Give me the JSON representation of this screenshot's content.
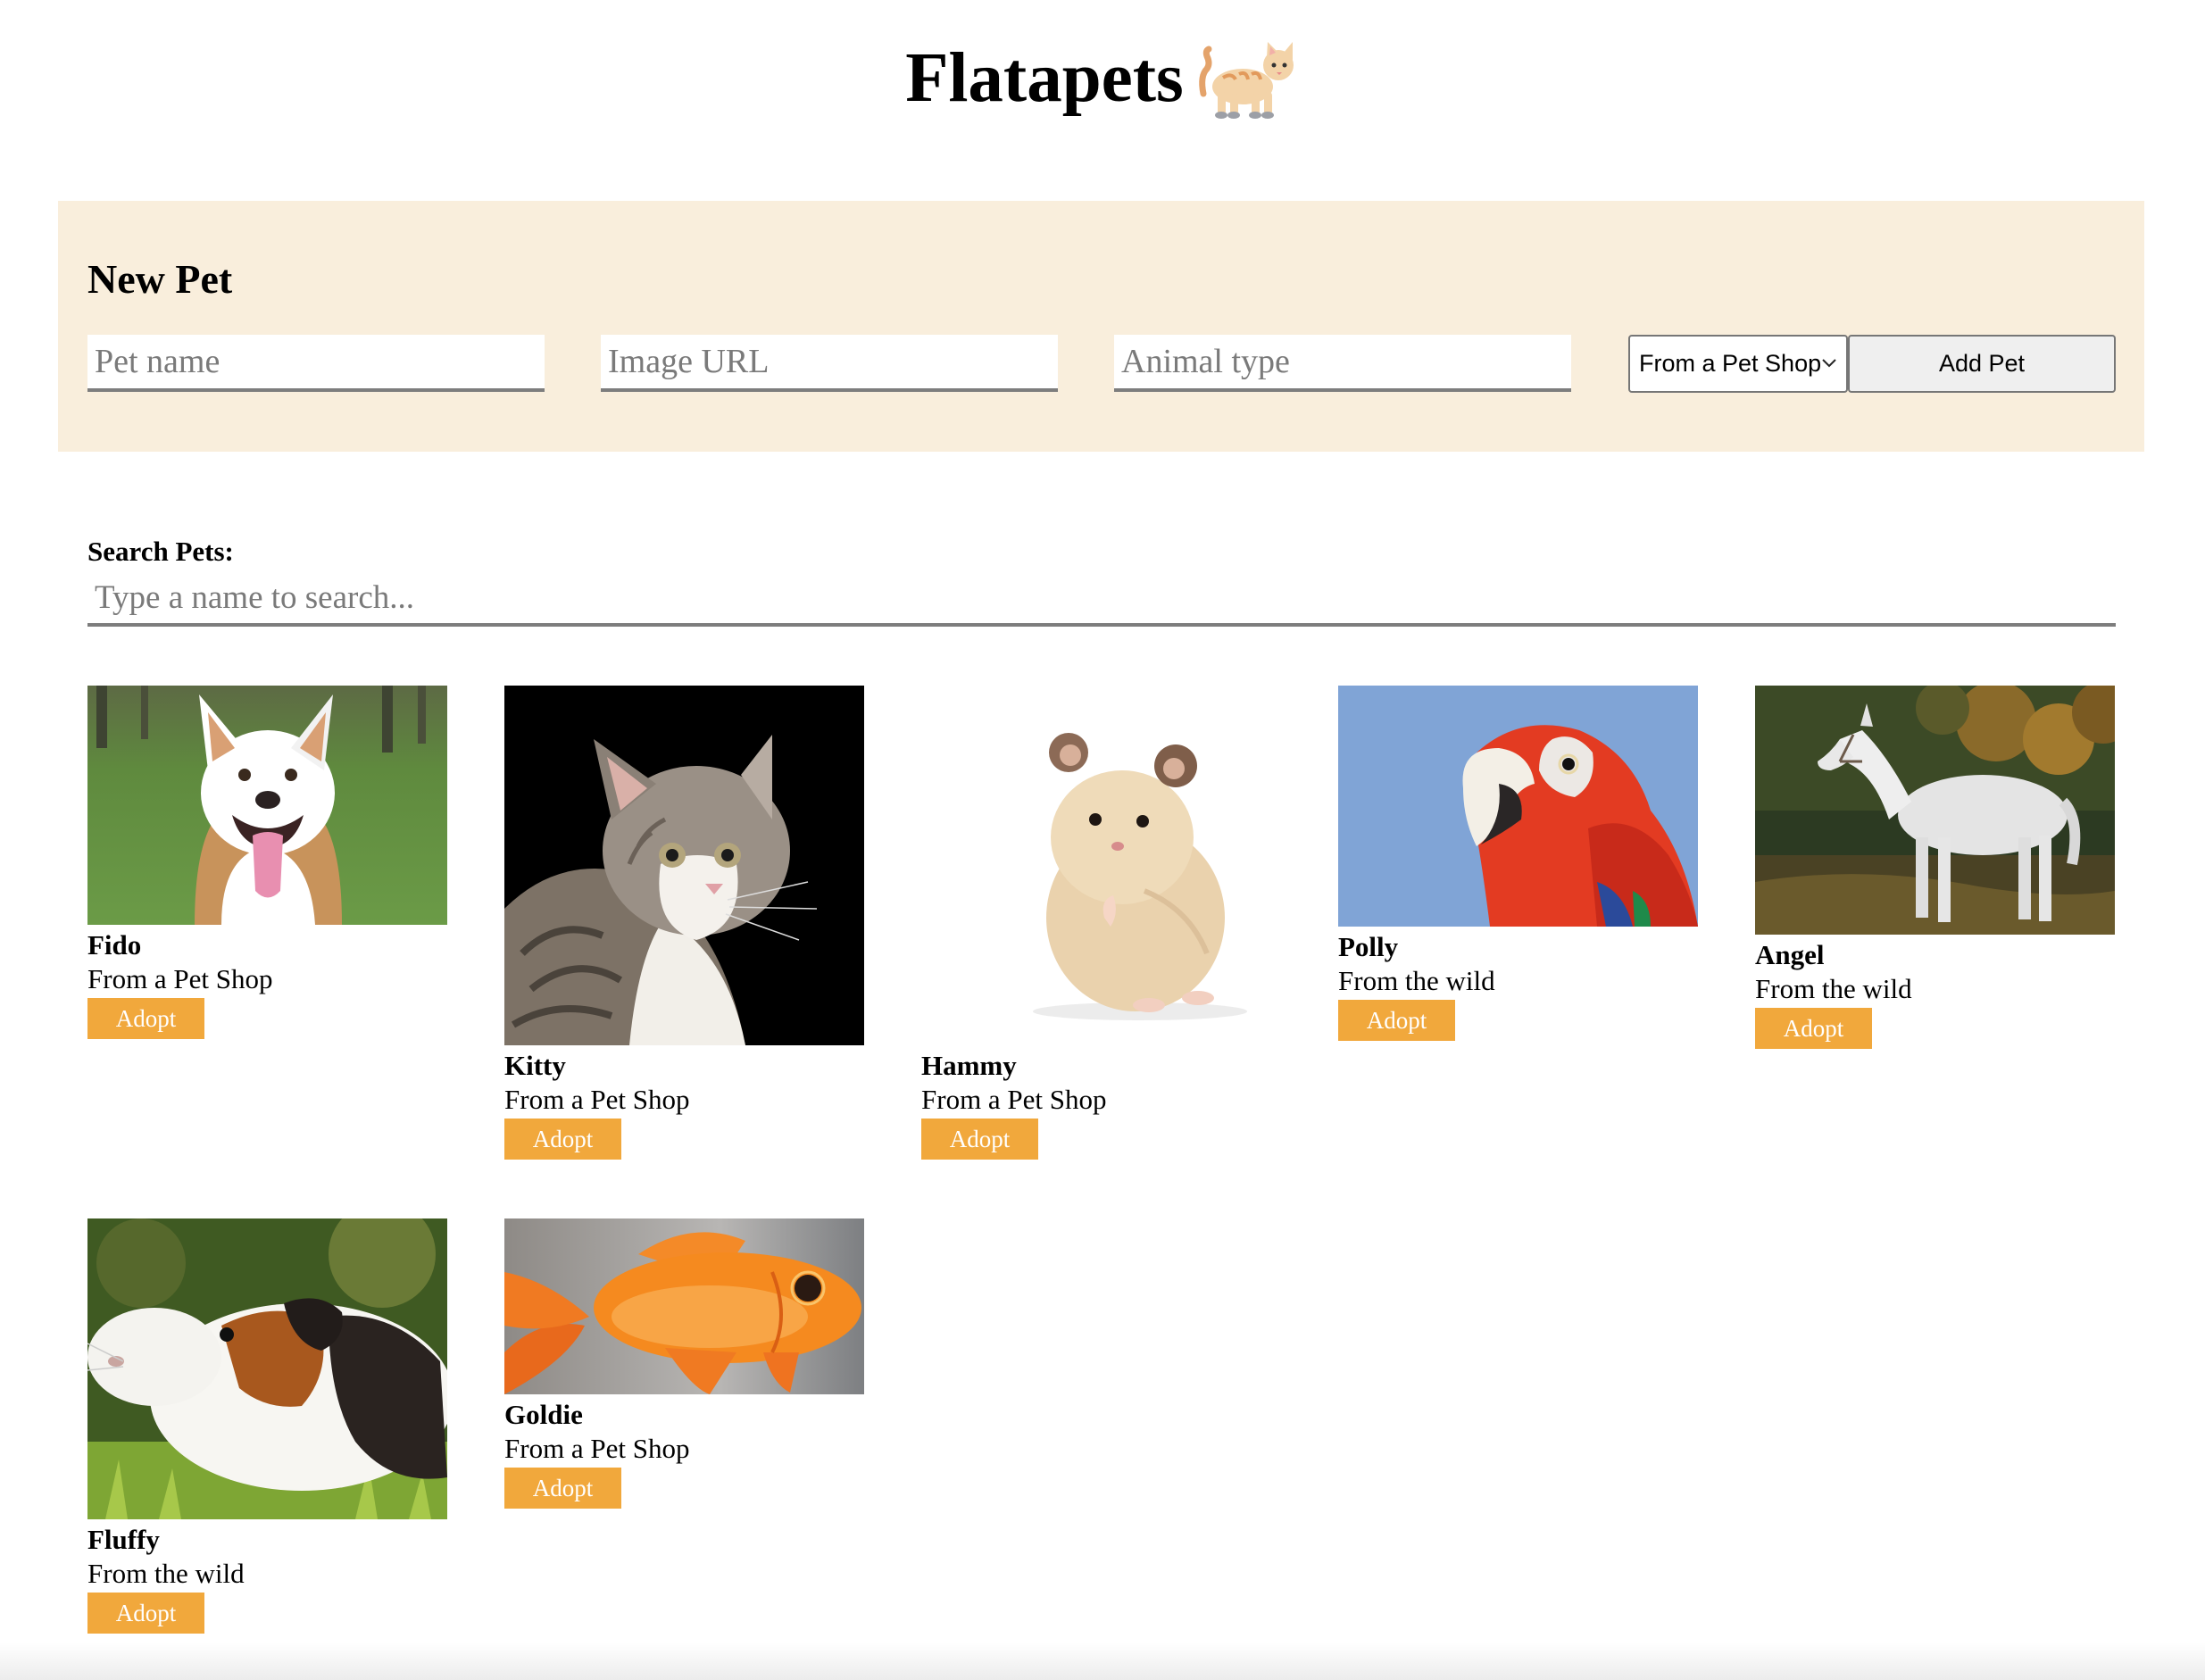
{
  "header": {
    "title": "Flatapets"
  },
  "new_pet_form": {
    "heading": "New Pet",
    "fields": {
      "name": {
        "placeholder": "Pet name",
        "value": ""
      },
      "image_url": {
        "placeholder": "Image URL",
        "value": ""
      },
      "animal_type": {
        "placeholder": "Animal type",
        "value": ""
      }
    },
    "source_select": {
      "selected": "From a Pet Shop"
    },
    "submit_label": "Add Pet"
  },
  "search": {
    "label": "Search Pets:",
    "placeholder": "Type a name to search...",
    "value": ""
  },
  "adopt_label": "Adopt",
  "pets": [
    {
      "name": "Fido",
      "source": "From a Pet Shop",
      "animal": "dog"
    },
    {
      "name": "Kitty",
      "source": "From a Pet Shop",
      "animal": "cat"
    },
    {
      "name": "Hammy",
      "source": "From a Pet Shop",
      "animal": "hamster"
    },
    {
      "name": "Polly",
      "source": "From the wild",
      "animal": "parrot"
    },
    {
      "name": "Angel",
      "source": "From the wild",
      "animal": "horse"
    },
    {
      "name": "Fluffy",
      "source": "From the wild",
      "animal": "guinea pig"
    },
    {
      "name": "Goldie",
      "source": "From a Pet Shop",
      "animal": "goldfish"
    }
  ],
  "colors": {
    "panel_background": "#f9eedc",
    "adopt_button": "#f1a83c",
    "input_underline": "#7d7d7d"
  },
  "icons": {
    "title_emoji": "cat-emoji-icon",
    "select_chevron": "chevron-down-icon"
  }
}
